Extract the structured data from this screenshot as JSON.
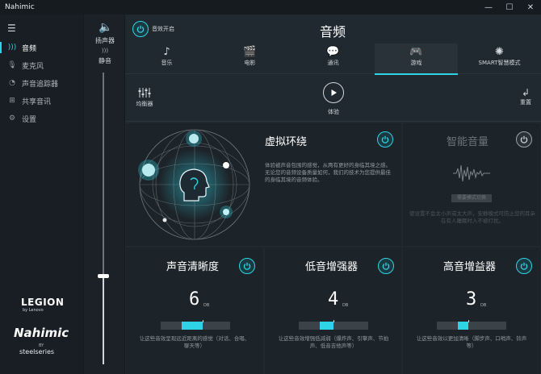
{
  "app": {
    "title": "Nahimic"
  },
  "window_controls": {
    "minimize": "—",
    "maximize": "☐",
    "close": "✕"
  },
  "sidebar": {
    "menu_icon": "hamburger-icon",
    "items": [
      {
        "label": "音频",
        "icon": "audio-wave-icon",
        "active": true
      },
      {
        "label": "麦克风",
        "icon": "microphone-icon",
        "active": false
      },
      {
        "label": "声音追踪器",
        "icon": "sound-tracker-icon",
        "active": false
      },
      {
        "label": "共享音讯",
        "icon": "share-icon",
        "active": false
      },
      {
        "label": "设置",
        "icon": "gear-icon",
        "active": false
      }
    ],
    "logos": {
      "legion": "LEGION",
      "legion_sub": "by Lenovo",
      "nahimic": "Nahimic",
      "by": "BY",
      "steelseries": "steelseries"
    }
  },
  "volume": {
    "speaker_label": "扬声器",
    "mute_label": "静音",
    "level": 0.3
  },
  "header": {
    "effect_toggle_label": "音效开启",
    "effect_on": true,
    "title": "音频"
  },
  "tabs": [
    {
      "label": "音乐",
      "icon": "music-note-icon",
      "active": false
    },
    {
      "label": "电影",
      "icon": "clapperboard-icon",
      "active": false
    },
    {
      "label": "通讯",
      "icon": "chat-bubble-icon",
      "active": false
    },
    {
      "label": "游戏",
      "icon": "gamepad-icon",
      "active": true
    },
    {
      "label": "SMART智慧模式",
      "icon": "smart-brain-icon",
      "active": false
    }
  ],
  "toolbar": {
    "equalizer_label": "均衡器",
    "experience_label": "体验",
    "reset_label": "重置"
  },
  "surround": {
    "title": "虚拟环绕",
    "on": true,
    "description": "体验被声音包围的感觉，从两有更好的身临其境之感。无论您的音频设备质量如何，我们的技术为您提供最佳的身临其境的音频体验。"
  },
  "smart_volume": {
    "title": "智能音量",
    "on": false,
    "preset_button": "需要模式切换",
    "description": "使设置不会太小声或太大声，安静模式可防止您的耳朵在有人睡眠时入不被打扰。"
  },
  "controls": [
    {
      "title": "声音清晰度",
      "value": "6",
      "unit": "DB",
      "level": 0.6,
      "on": true,
      "caption": "让这些音效呈现远近距离的感觉（对话、合唱、聊天等）"
    },
    {
      "title": "低音增强器",
      "value": "4",
      "unit": "DB",
      "level": 0.4,
      "on": true,
      "caption": "让这些音效增强低减弱（爆炸声、引擎声、节拍声、低音吉他声等）"
    },
    {
      "title": "高音增益器",
      "value": "3",
      "unit": "DB",
      "level": 0.3,
      "on": true,
      "caption": "让这些音效以更加清晰（脚步声、口哨声、铃声等）"
    }
  ],
  "colors": {
    "accent": "#2fd3e6",
    "bg": "#1f262c",
    "panel": "#1d2429"
  }
}
